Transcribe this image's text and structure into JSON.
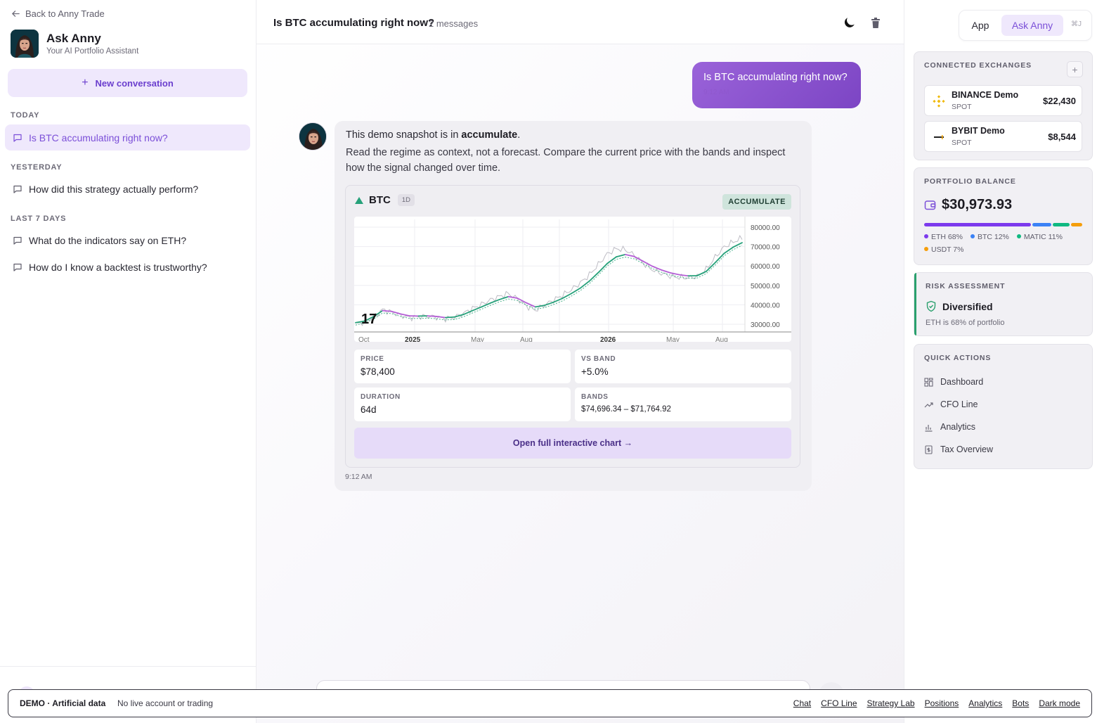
{
  "sidebar": {
    "back_label": "Back to Anny Trade",
    "brand_title": "Ask Anny",
    "brand_subtitle": "Your AI Portfolio Assistant",
    "new_conversation": "New conversation",
    "sections": [
      {
        "title": "TODAY",
        "items": [
          "Is BTC accumulating right now?"
        ]
      },
      {
        "title": "YESTERDAY",
        "items": [
          "How did this strategy actually perform?"
        ]
      },
      {
        "title": "LAST 7 DAYS",
        "items": [
          "What do the indicators say on ETH?",
          "How do I know a backtest is trustworthy?"
        ]
      }
    ]
  },
  "header": {
    "title": "Is BTC accumulating right now?",
    "count": "2 messages"
  },
  "messages": {
    "user_text": "Is BTC accumulating right now?",
    "user_time": "9:12 AM",
    "bot_intro": "This demo snapshot is in ",
    "bot_regime_word": "accumulate",
    "bot_intro_end": ".",
    "bot_body": "Read the regime as context, not a forecast. Compare the current price with the bands and inspect how the signal changed over time.",
    "bot_time": "9:12 AM"
  },
  "signal_card": {
    "symbol": "BTC",
    "timeframe": "1D",
    "regime": "ACCUMULATE",
    "stats": {
      "price_label": "PRICE",
      "price": "$78,400",
      "vsband_label": "VS BAND",
      "vsband": "+5.0%",
      "duration_label": "DURATION",
      "duration": "64d",
      "bands_label": "BANDS",
      "bands": "$74,696.34 – $71,764.92"
    },
    "open_chart": "Open full interactive chart →"
  },
  "chart_data": {
    "type": "line",
    "x_ticks": [
      "Oct",
      "2025",
      "May",
      "Aug",
      "2026",
      "May",
      "Aug"
    ],
    "y_ticks": [
      "80000.00",
      "70000.00",
      "60000.00",
      "50000.00",
      "40000.00",
      "30000.00"
    ],
    "ylim": [
      26000,
      84000
    ],
    "series": [
      {
        "values": [
          30000,
          31200,
          33800,
          37500,
          36200,
          34500,
          33400,
          33800,
          34100,
          33700,
          32800,
          33500,
          35600,
          38100,
          40200,
          42500,
          44300,
          45800,
          43100,
          39400,
          37200,
          39800,
          42400,
          44900,
          47800,
          51300,
          55400,
          60800,
          66200,
          68900,
          68400,
          65600,
          61400,
          58100,
          56200,
          54800,
          54100,
          53900,
          54600,
          58200,
          64500,
          69800,
          72400,
          74400
        ]
      },
      {
        "values": [
          30800,
          31600,
          33900,
          37000,
          36600,
          35300,
          34300,
          34200,
          34300,
          34000,
          33400,
          33700,
          35000,
          37000,
          38900,
          40900,
          42700,
          44200,
          43400,
          41000,
          38900,
          39700,
          41300,
          43300,
          45800,
          48600,
          52200,
          56600,
          61300,
          64700,
          65900,
          64900,
          62400,
          59900,
          58000,
          56500,
          55500,
          54900,
          55000,
          57200,
          61700,
          66500,
          69700,
          72000
        ]
      },
      {
        "values": [
          29500,
          30800,
          32600,
          35800,
          35500,
          34000,
          33000,
          33000,
          33100,
          32800,
          32200,
          32400,
          33800,
          35800,
          37700,
          39700,
          41500,
          43000,
          42200,
          39800,
          37700,
          38500,
          40100,
          42000,
          44500,
          47300,
          50900,
          55300,
          60000,
          63400,
          64600,
          63700,
          61200,
          58700,
          56800,
          55300,
          54300,
          53700,
          53800,
          56000,
          60400,
          65200,
          68400,
          70700
        ]
      }
    ]
  },
  "right": {
    "toggle_app": "App",
    "toggle_anny": "Ask Anny",
    "shortcut": "⌘J",
    "exchanges_title": "CONNECTED EXCHANGES",
    "exchanges": [
      {
        "name": "BINANCE Demo",
        "type": "SPOT",
        "value": "$22,430"
      },
      {
        "name": "BYBIT Demo",
        "type": "SPOT",
        "value": "$8,544"
      }
    ],
    "balance_title": "PORTFOLIO BALANCE",
    "balance": "$30,973.93",
    "allocation": [
      {
        "label": "ETH 68%",
        "pct": 68,
        "color": "#7c3aed"
      },
      {
        "label": "BTC 12%",
        "pct": 12,
        "color": "#3b82f6"
      },
      {
        "label": "MATIC 11%",
        "pct": 11,
        "color": "#10b981"
      },
      {
        "label": "USDT 7%",
        "pct": 7,
        "color": "#f59e0b"
      }
    ],
    "risk_title": "RISK ASSESSMENT",
    "risk_value": "Diversified",
    "risk_note": "ETH is 68% of portfolio",
    "quick_title": "QUICK ACTIONS",
    "quick_actions": [
      "Dashboard",
      "CFO Line",
      "Analytics",
      "Tax Overview"
    ]
  },
  "demo_bar": {
    "tag": "DEMO · Artificial data",
    "note": "No live account or trading",
    "links": [
      "Chat",
      "CFO Line",
      "Strategy Lab",
      "Positions",
      "Analytics",
      "Bots",
      "Dark mode"
    ]
  }
}
